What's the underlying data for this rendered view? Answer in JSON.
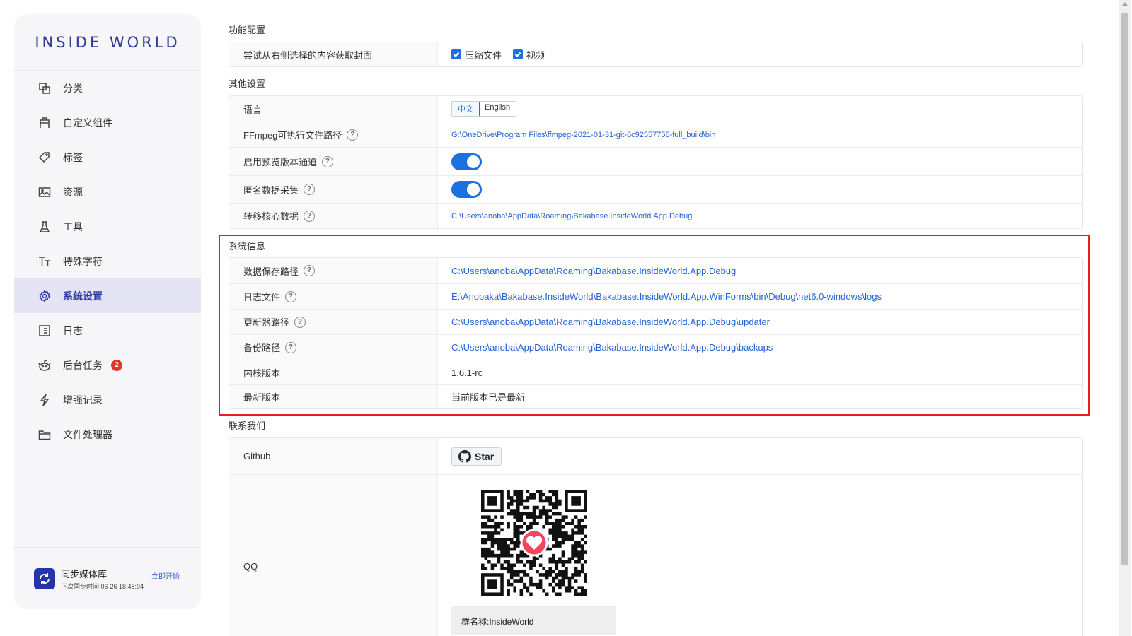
{
  "sidebar": {
    "logo": "INSIDE WORLD",
    "items": [
      {
        "label": "分类",
        "icon": "category-icon"
      },
      {
        "label": "自定义组件",
        "icon": "component-icon"
      },
      {
        "label": "标签",
        "icon": "tag-icon"
      },
      {
        "label": "资源",
        "icon": "image-icon"
      },
      {
        "label": "工具",
        "icon": "flask-icon"
      },
      {
        "label": "特殊字符",
        "icon": "text-icon"
      },
      {
        "label": "系统设置",
        "icon": "gear-icon",
        "active": true
      },
      {
        "label": "日志",
        "icon": "log-icon"
      },
      {
        "label": "后台任务",
        "icon": "robot-icon",
        "badge": "2"
      },
      {
        "label": "增强记录",
        "icon": "lightning-icon"
      },
      {
        "label": "文件处理器",
        "icon": "folder-icon"
      }
    ],
    "sync": {
      "title": "同步媒体库",
      "next": "下次同步时间 06-26 18:48:04",
      "action": "立即开始"
    }
  },
  "feature_config": {
    "title": "功能配置",
    "cover_label": "尝试从右侧选择的内容获取封面",
    "options": [
      {
        "label": "压缩文件",
        "checked": true
      },
      {
        "label": "视频",
        "checked": true
      }
    ]
  },
  "other_settings": {
    "title": "其他设置",
    "language_label": "语言",
    "language_options": [
      "中文",
      "English"
    ],
    "language_selected": "中文",
    "ffmpeg_label": "FFmpeg可执行文件路径",
    "ffmpeg_path": "G:\\OneDrive\\Program Files\\ffmpeg-2021-01-31-git-6c92557756-full_build\\bin",
    "preview_label": "启用预览版本通道",
    "preview_on": true,
    "anon_label": "匿名数据采集",
    "anon_on": true,
    "migrate_label": "转移核心数据",
    "migrate_path": "C:\\Users\\anoba\\AppData\\Roaming\\Bakabase.InsideWorld.App.Debug"
  },
  "system_info": {
    "title": "系统信息",
    "rows": [
      {
        "label": "数据保存路径",
        "value": "C:\\Users\\anoba\\AppData\\Roaming\\Bakabase.InsideWorld.App.Debug"
      },
      {
        "label": "日志文件",
        "value": "E:\\Anobaka\\Bakabase.InsideWorld\\Bakabase.InsideWorld.App.WinForms\\bin\\Debug\\net6.0-windows\\logs"
      },
      {
        "label": "更新器路径",
        "value": "C:\\Users\\anoba\\AppData\\Roaming\\Bakabase.InsideWorld.App.Debug\\updater"
      },
      {
        "label": "备份路径",
        "value": "C:\\Users\\anoba\\AppData\\Roaming\\Bakabase.InsideWorld.App.Debug\\backups"
      },
      {
        "label": "内核版本",
        "value": "1.6.1-rc"
      },
      {
        "label": "最新版本",
        "value": "当前版本已是最新"
      }
    ]
  },
  "contact": {
    "title": "联系我们",
    "github_label": "Github",
    "star_label": "Star",
    "qq_label": "QQ",
    "group_name": "群名称:InsideWorld"
  },
  "colors": {
    "accent": "#1e6fe0",
    "brand": "#2d3a9c",
    "highlight_border": "#e81e1e"
  }
}
